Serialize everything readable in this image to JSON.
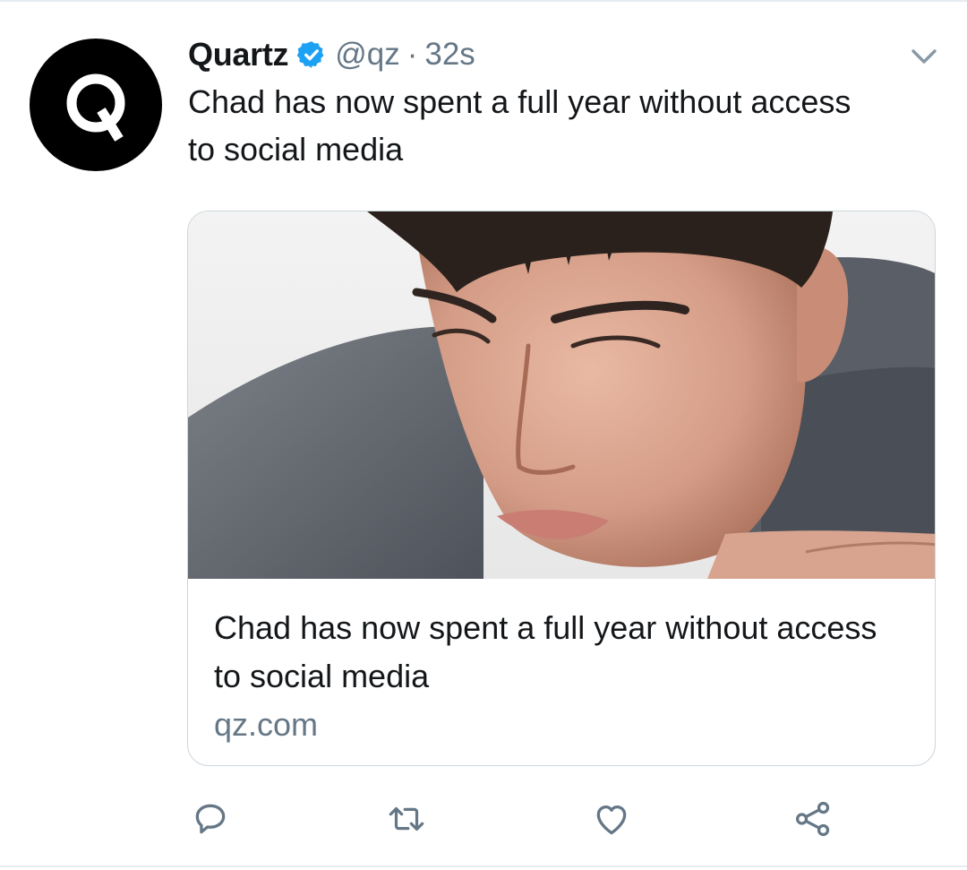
{
  "tweet": {
    "author_name": "Quartz",
    "handle": "@qz",
    "separator": "·",
    "timestamp": "32s",
    "text": "Chad has now spent a full year without access to social media",
    "avatar_letter": "Q"
  },
  "card": {
    "title": "Chad has now spent a full year without access to social media",
    "domain": "qz.com",
    "image_description": "photo-of-pensive-young-man"
  },
  "actions": {
    "reply_icon": "reply-icon",
    "retweet_icon": "retweet-icon",
    "like_icon": "heart-icon",
    "share_icon": "share-icon"
  },
  "colors": {
    "text_primary": "#14171a",
    "text_secondary": "#657786",
    "verified_blue": "#1da1f2",
    "border": "#ccd6dd"
  }
}
